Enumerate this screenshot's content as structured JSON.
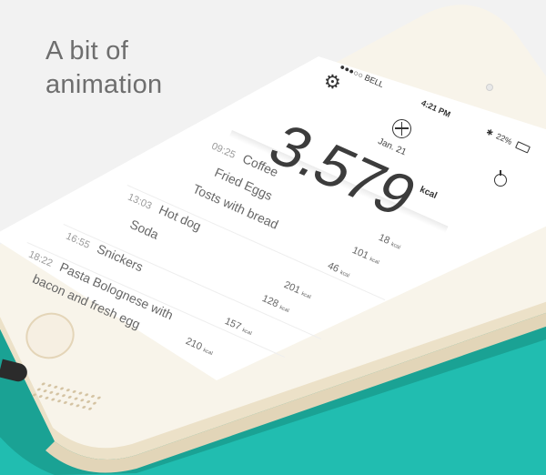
{
  "colors": {
    "teal_background": "#21bdb0",
    "phone_shell": "#efe6d2",
    "screen": "#ffffff",
    "headline_text": "#6e6e6e"
  },
  "headline": {
    "line1": "A bit of",
    "line2": "animation"
  },
  "status_bar": {
    "carrier": "●●●○○ BELL",
    "time": "4:21 PM",
    "battery": "22%",
    "icons": [
      "signal-icon",
      "wifi-icon",
      "bluetooth-icon",
      "battery-icon"
    ]
  },
  "summary": {
    "date": "Jan. 21",
    "total": "3.579",
    "unit": "kcal",
    "add_icon": "plus-circle-icon",
    "settings_icon": "gear-icon",
    "timer_icon": "stopwatch-icon"
  },
  "entries": [
    {
      "time": "09:25",
      "items": [
        {
          "name": "Coffee",
          "kcal": "18"
        },
        {
          "name": "Fried Eggs",
          "kcal": "101"
        },
        {
          "name": "Tosts with bread",
          "kcal": "46"
        }
      ]
    },
    {
      "time": "13:03",
      "items": [
        {
          "name": "Hot dog",
          "kcal": "201"
        },
        {
          "name": "Soda",
          "kcal": "128"
        }
      ]
    },
    {
      "time": "16:55",
      "items": [
        {
          "name": "Snickers",
          "kcal": "157"
        }
      ]
    },
    {
      "time": "18:22",
      "items": [
        {
          "name": "Pasta Bolognese with",
          "kcal": "210"
        },
        {
          "name": "bacon and fresh egg",
          "kcal": ""
        }
      ]
    }
  ],
  "kcal_suffix": "kcal"
}
